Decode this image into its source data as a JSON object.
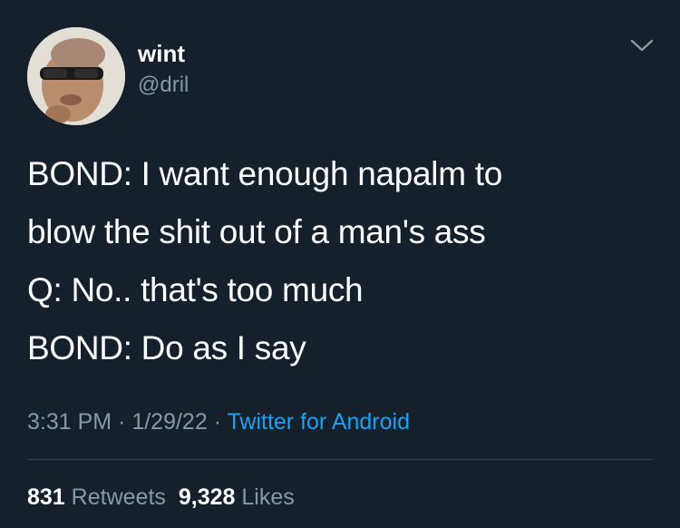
{
  "author": {
    "display_name": "wint",
    "handle": "@dril",
    "avatar_icon": "profile-photo"
  },
  "menu": {
    "icon": "chevron-down-icon"
  },
  "tweet": {
    "lines": [
      "BOND: I want enough napalm to",
      "blow the shit out of a man's ass",
      "Q: No.. that's too much",
      "BOND: Do as I say"
    ]
  },
  "meta": {
    "time": "3:31 PM",
    "separator": " · ",
    "date": "1/29/22",
    "source": "Twitter for Android"
  },
  "stats": {
    "retweets_count": "831",
    "retweets_label": "Retweets",
    "likes_count": "9,328",
    "likes_label": "Likes"
  },
  "colors": {
    "background": "#15202b",
    "text_primary": "#ffffff",
    "text_secondary": "#8899a6",
    "link": "#1da1f2",
    "divider": "#38444d"
  }
}
